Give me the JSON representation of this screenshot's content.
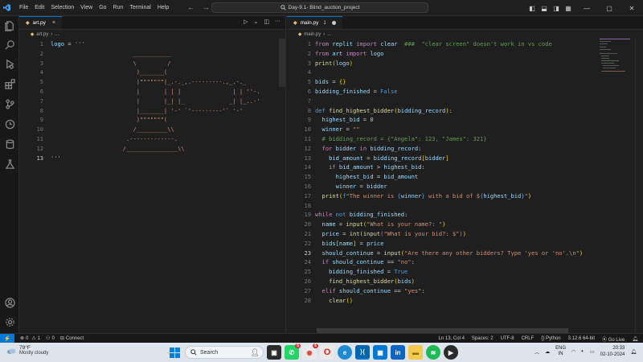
{
  "titlebar": {
    "menu": [
      "File",
      "Edit",
      "Selection",
      "View",
      "Go",
      "Run",
      "Terminal",
      "Help"
    ],
    "search_text": "Day-9.1- Blind_auction_project",
    "back": "←",
    "forward": "→"
  },
  "activity": {
    "icons": [
      "explorer-icon",
      "search-icon",
      "run-debug-icon",
      "extensions-icon",
      "source-control-icon",
      "timeline-icon",
      "database-icon",
      "testing-icon",
      "account-icon",
      "settings-icon"
    ]
  },
  "left_editor": {
    "tab_label": "art.py",
    "tab_close": "×",
    "breadcrumb_file": "art.py",
    "breadcrumb_sep": "›",
    "breadcrumb_more": "...",
    "lines": [
      {
        "n": "1",
        "text": "logo = '''"
      },
      {
        "n": "2",
        "text": "                        ___________"
      },
      {
        "n": "3",
        "text": "                        \\         /"
      },
      {
        "n": "4",
        "text": "                         )_______("
      },
      {
        "n": "5",
        "text": "                         |\"\"\"\"\"\"\"|_.-._,.---------.,_.-._"
      },
      {
        "n": "6",
        "text": "                         |       | | |               | | ''-."
      },
      {
        "n": "7",
        "text": "                         |       |_| |_             _| |_..-'"
      },
      {
        "n": "8",
        "text": "                         |_______| '-' `'---------'` '-'"
      },
      {
        "n": "9",
        "text": "                         )\"\"\"\"\"\"\"("
      },
      {
        "n": "10",
        "text": "                        /_________\\\\"
      },
      {
        "n": "11",
        "text": "                      .-------------."
      },
      {
        "n": "12",
        "text": "                     /_______________\\\\"
      },
      {
        "n": "13",
        "text": "'''"
      }
    ],
    "current_line": "13"
  },
  "right_editor": {
    "tab_label": "main.py",
    "tab_problems": "1",
    "breadcrumb_file": "main.py",
    "breadcrumb_sep": "›",
    "breadcrumb_more": "...",
    "current_line": "23"
  },
  "statusbar": {
    "remote": "⚡",
    "errors": "0",
    "warnings": "1",
    "ports": "0",
    "connect": "Connect",
    "position": "Ln 13, Col 4",
    "spaces": "Spaces: 2",
    "encoding": "UTF-8",
    "eol": "CRLF",
    "language": "Python",
    "interpreter": "3.12.6 64-bit",
    "golive": "Go Live"
  },
  "taskbar": {
    "temp": "79°F",
    "condition": "Mostly cloudy",
    "search": "Search",
    "lang_top": "ENG",
    "lang_bottom": "IN",
    "time": "20:33",
    "date": "02-10-2024",
    "whatsapp_badge": "5",
    "chrome_badge": "6"
  }
}
